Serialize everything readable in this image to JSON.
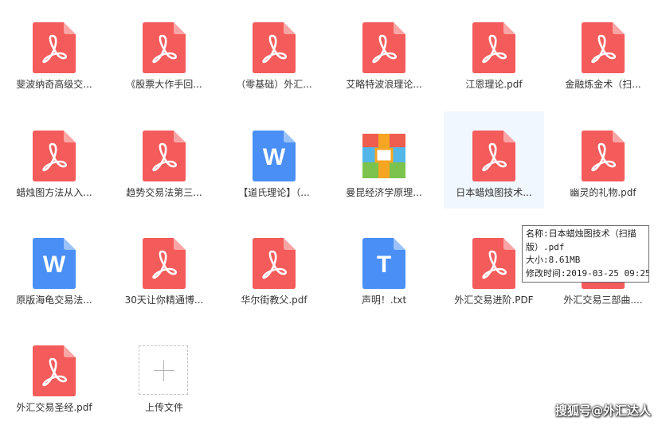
{
  "files": [
    {
      "name": "斐波纳奇高级交...",
      "type": "pdf"
    },
    {
      "name": "《股票大作手回...",
      "type": "pdf"
    },
    {
      "name": "（零基础）外汇...",
      "type": "pdf"
    },
    {
      "name": "艾略特波浪理论...",
      "type": "pdf"
    },
    {
      "name": "江恩理论.pdf",
      "type": "pdf"
    },
    {
      "name": "金融炼金术（扫...",
      "type": "pdf"
    },
    {
      "name": "蜡烛图方法从入...",
      "type": "pdf"
    },
    {
      "name": "趋势交易法第三...",
      "type": "pdf"
    },
    {
      "name": "【道氏理论】（...",
      "type": "word"
    },
    {
      "name": "曼昆经济学原理...",
      "type": "archive"
    },
    {
      "name": "日本蜡烛图技术...",
      "type": "pdf",
      "selected": true
    },
    {
      "name": "幽灵的礼物.pdf",
      "type": "pdf"
    },
    {
      "name": "原版海龟交易法...",
      "type": "word"
    },
    {
      "name": "30天让你精通博...",
      "type": "pdf"
    },
    {
      "name": "华尔街教父.pdf",
      "type": "pdf"
    },
    {
      "name": "声明！.txt",
      "type": "txt"
    },
    {
      "name": "外汇交易进阶.PDF",
      "type": "pdf"
    },
    {
      "name": "外汇交易三部曲....",
      "type": "pdf"
    },
    {
      "name": "外汇交易圣经.pdf",
      "type": "pdf"
    }
  ],
  "upload": {
    "label": "上传文件"
  },
  "tooltip": {
    "lines": [
      "名称:日本蜡烛图技术（扫描",
      "版）.pdf",
      "大小:8.61MB",
      "修改时间:2019-03-25 09:25"
    ]
  },
  "watermark": "搜狐号@外汇达人",
  "colors": {
    "pdf": "#f45b5b",
    "word": "#4a8ff5",
    "txt": "#4a8ff5",
    "selected_bg": "#f1f7fe"
  },
  "icons": {
    "pdf": "pdf-file-icon",
    "word": "word-file-icon",
    "txt": "text-file-icon",
    "archive": "archive-file-icon",
    "upload": "plus-icon"
  }
}
